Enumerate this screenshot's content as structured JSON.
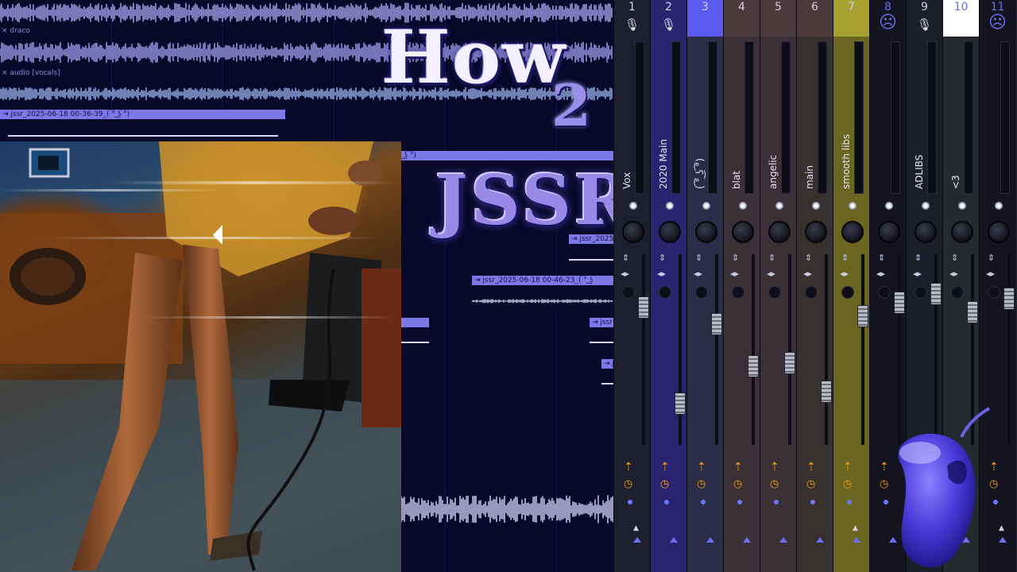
{
  "playlist": {
    "tracks": [
      {
        "label": ""
      },
      {
        "label": "× draco"
      },
      {
        "label": "× audio [vocals]"
      }
    ],
    "clips": [
      {
        "name": "⇥ jssr_2025-06-18 00-36-39_( ͡° ͜ʖ ͡°)"
      },
      {
        "name": "͡° ͜ʖ ͡°)"
      },
      {
        "name": "⇥ jssr_2025"
      },
      {
        "name": "⇥ jssr_2025-06-18 00-46-23_( ͡° ͜ʖ"
      },
      {
        "name": "⇥ jssr"
      },
      {
        "name": "⇥ jss"
      }
    ]
  },
  "title": {
    "line1": "How",
    "line2": "2",
    "line3": "JSSR"
  },
  "mixer": {
    "strips": [
      {
        "num": "1",
        "name": "Vox",
        "icon": "microphone-icon",
        "color": "#1d1f2e"
      },
      {
        "num": "2",
        "name": "2020 Main",
        "icon": "microphone-icon",
        "color": "#2a2470"
      },
      {
        "num": "3",
        "name": "( ͡° ͜ʖ ͡°)",
        "icon": "",
        "color": "#2a2c48"
      },
      {
        "num": "4",
        "name": "blat",
        "icon": "",
        "color": "#3a3036"
      },
      {
        "num": "5",
        "name": "angelic",
        "icon": "",
        "color": "#3a3036"
      },
      {
        "num": "6",
        "name": "main",
        "icon": "",
        "color": "#36302e"
      },
      {
        "num": "7",
        "name": "smooth libs",
        "icon": "",
        "color": "#6a6520"
      },
      {
        "num": "8",
        "name": "",
        "icon": "sad-face-icon",
        "color": "#141420"
      },
      {
        "num": "9",
        "name": "ADLIBS",
        "icon": "microphone-icon",
        "color": "#1c1e2a"
      },
      {
        "num": "10",
        "name": "<3",
        "icon": "",
        "color": "#262a2c"
      },
      {
        "num": "11",
        "name": "",
        "icon": "sad-face-icon",
        "color": "#141420"
      }
    ],
    "fader_levels": [
      0.75,
      0.18,
      0.65,
      0.4,
      0.42,
      0.25,
      0.7,
      0.78,
      0.83,
      0.72,
      0.8
    ],
    "icons": {
      "route": "arrow-route-icon",
      "clock": "clock-icon",
      "stereo": "stereo-icon",
      "up": "updown-icon"
    }
  },
  "colors": {
    "playlist_bg": "#08082a",
    "clip": "#7c78e6",
    "wave": "#a6a2f4",
    "accent": "#6d64f0"
  }
}
